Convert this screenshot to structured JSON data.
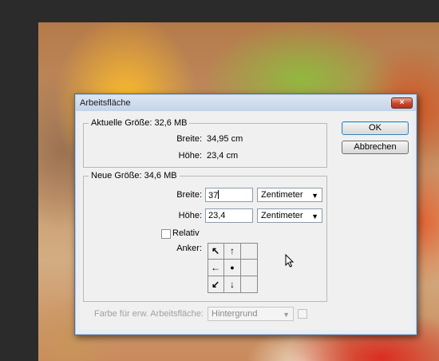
{
  "dialog": {
    "title": "Arbeitsfläche",
    "close_glyph": "×",
    "current": {
      "title": "Aktuelle Größe: 32,6 MB",
      "width_label": "Breite:",
      "width_value": "34,95 cm",
      "height_label": "Höhe:",
      "height_value": "23,4 cm"
    },
    "new": {
      "title": "Neue Größe: 34,6 MB",
      "width_label": "Breite:",
      "width_value": "37",
      "width_unit": "Zentimeter",
      "height_label": "Höhe:",
      "height_value": "23,4",
      "height_unit": "Zentimeter",
      "relative_label": "Relativ",
      "relative_checked": false,
      "anchor_label": "Anker:",
      "anchor_arrows": [
        "↖",
        "↑",
        "",
        "←",
        "●",
        "",
        "↙",
        "↓",
        ""
      ]
    },
    "extension_label": "Farbe für erw. Arbeitsfläche:",
    "extension_value": "Hintergrund",
    "ok_label": "OK",
    "cancel_label": "Abbrechen"
  }
}
